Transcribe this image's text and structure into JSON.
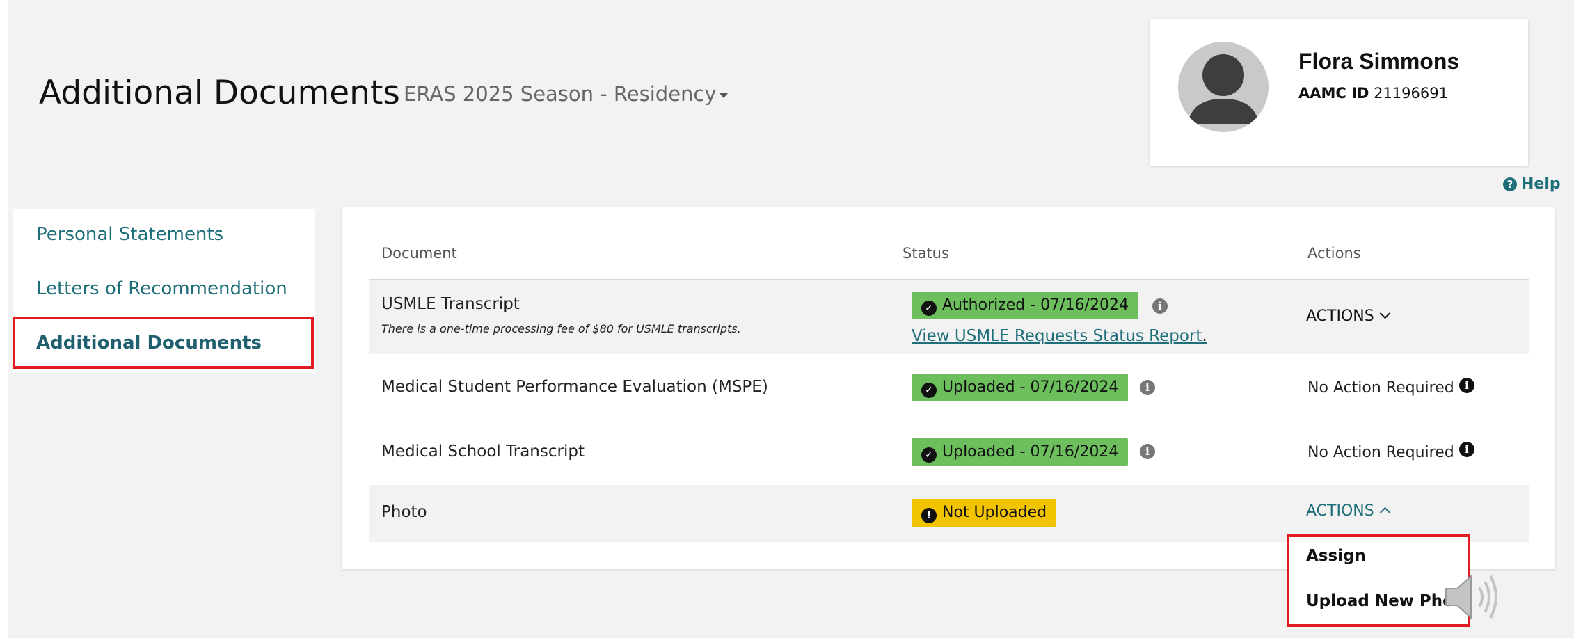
{
  "header": {
    "page_title": "Additional Documents",
    "season_selector": "ERAS 2025 Season - Residency"
  },
  "profile": {
    "name": "Flora Simmons",
    "id_label": "AAMC ID",
    "id_value": "21196691"
  },
  "help": {
    "label": "Help",
    "icon": "question-circle-icon"
  },
  "sidebar": {
    "items": [
      {
        "label": "Personal Statements",
        "active": false
      },
      {
        "label": "Letters of Recommendation",
        "active": false
      },
      {
        "label": "Additional Documents",
        "active": true
      }
    ]
  },
  "table": {
    "columns": [
      "Document",
      "Status",
      "Actions"
    ],
    "rows": [
      {
        "document": "USMLE Transcript",
        "note": "There is a one-time processing fee of $80 for USMLE transcripts.",
        "status": "Authorized - 07/16/2024",
        "status_color": "#6dbf5e",
        "status_link": "View USMLE Requests Status Report",
        "action": "ACTIONS"
      },
      {
        "document": "Medical Student Performance Evaluation (MSPE)",
        "status": "Uploaded - 07/16/2024",
        "status_color": "#6dbf5e",
        "action": "No Action Required"
      },
      {
        "document": "Medical School Transcript",
        "status": "Uploaded - 07/16/2024",
        "status_color": "#6dbf5e",
        "action": "No Action Required"
      },
      {
        "document": "Photo",
        "status": "Not Uploaded",
        "status_color": "#f2c400",
        "action": "ACTIONS"
      }
    ]
  },
  "actions_menu": {
    "items": [
      "Assign",
      "Upload New Photo"
    ]
  },
  "colors": {
    "accent": "#1f6f7a",
    "highlight": "#e01b22",
    "success": "#6dbf5e",
    "warning": "#f2c400"
  }
}
